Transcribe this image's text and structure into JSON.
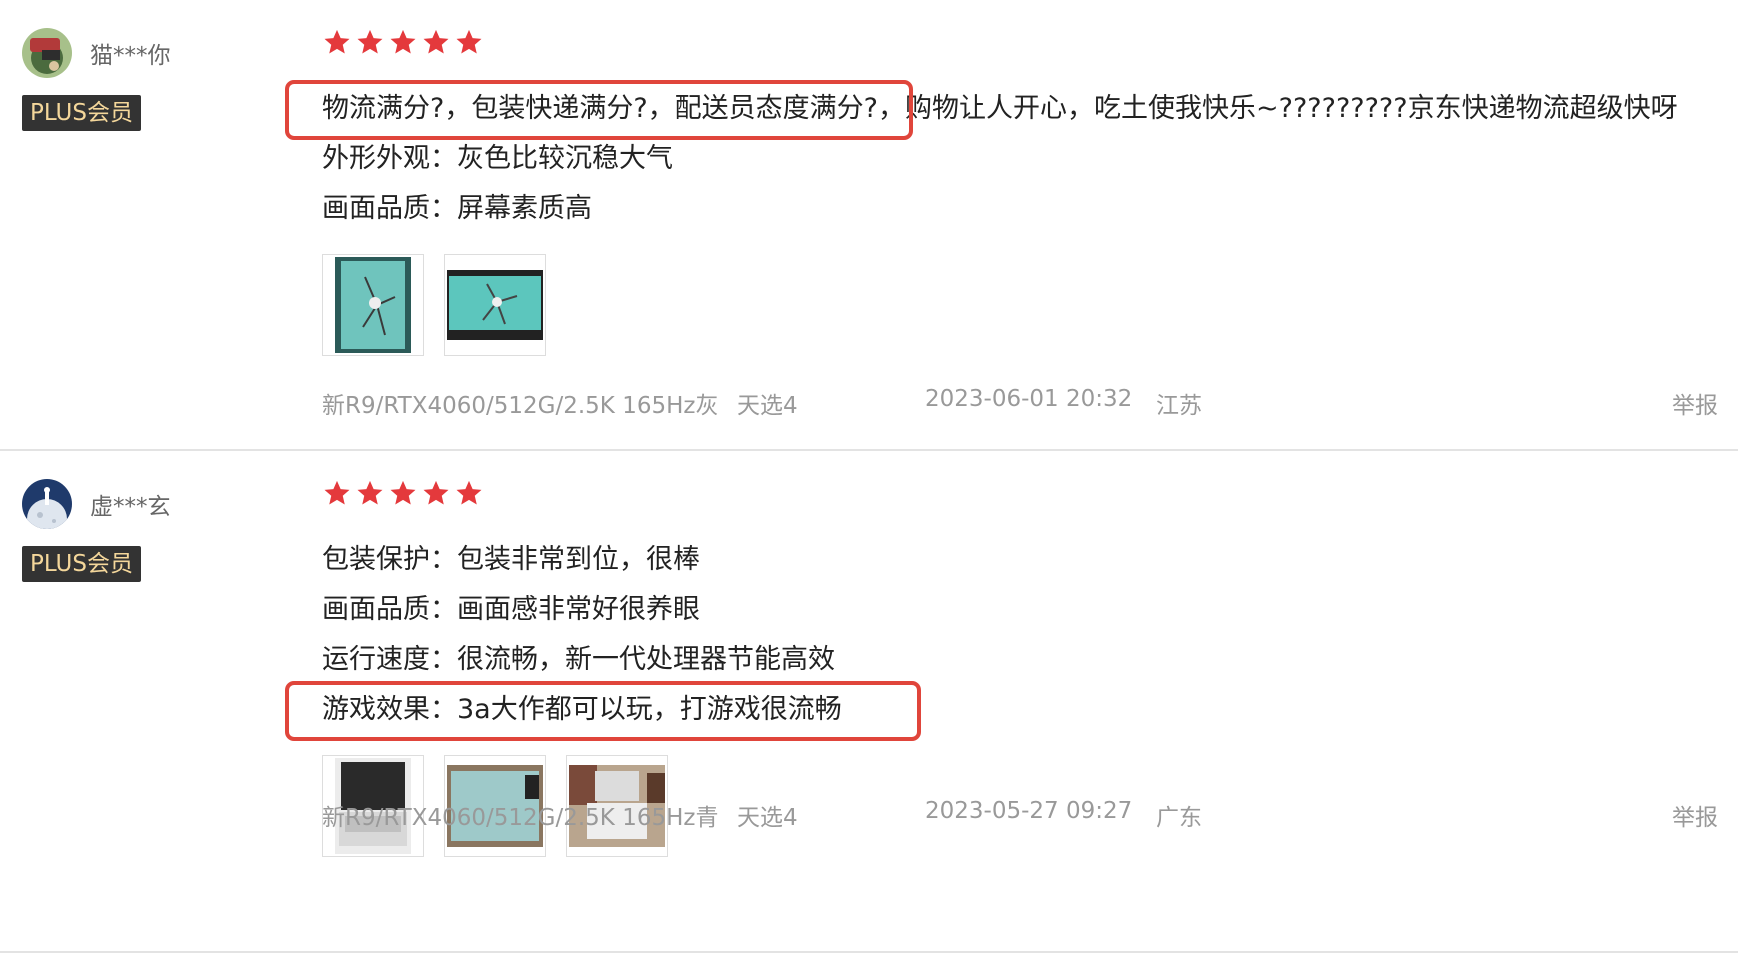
{
  "reviews": [
    {
      "user": {
        "name": "猫***你",
        "badge": "PLUS会员",
        "avatar_icon": "game-character-avatar"
      },
      "rating": 5,
      "lines": [
        {
          "highlight": "物流满分?，包装快递满分?，配送员态度满分?，",
          "rest": "购物让人开心，吃土使我快乐~?????????京东快递物流超级快呀"
        },
        {
          "text": "外形外观：灰色比较沉稳大气"
        },
        {
          "text": "画面品质：屏幕素质高"
        }
      ],
      "photos": [
        "teal-laptop-screen-photo",
        "teal-screen-wallpaper-photo"
      ],
      "meta": {
        "variant": "新R9/RTX4060/512G/2.5K 165Hz灰",
        "model": "天选4",
        "date": "2023-06-01 20:32",
        "location": "江苏"
      },
      "report_label": "举报"
    },
    {
      "user": {
        "name": "虚***玄",
        "badge": "PLUS会员",
        "avatar_icon": "moon-astronaut-avatar"
      },
      "rating": 5,
      "lines": [
        {
          "text": "包装保护：包装非常到位，很棒"
        },
        {
          "text": "画面品质：画面感非常好很养眼"
        },
        {
          "text": "运行速度：很流畅，新一代处理器节能高效"
        },
        {
          "text": "游戏效果：3a大作都可以玩，打游戏很流畅"
        }
      ],
      "photos": [
        "laptop-open-photo",
        "laptop-lid-teal-photo",
        "laptop-on-desk-photo"
      ],
      "meta": {
        "variant": "新R9/RTX4060/512G/2.5K 165Hz青",
        "model": "天选4",
        "date": "2023-05-27 09:27",
        "location": "广东"
      },
      "report_label": "举报"
    }
  ],
  "colors": {
    "star": "#e4393c",
    "highlight_box": "#e0453b",
    "badge_bg": "#333333",
    "badge_text": "#f4d79b"
  }
}
